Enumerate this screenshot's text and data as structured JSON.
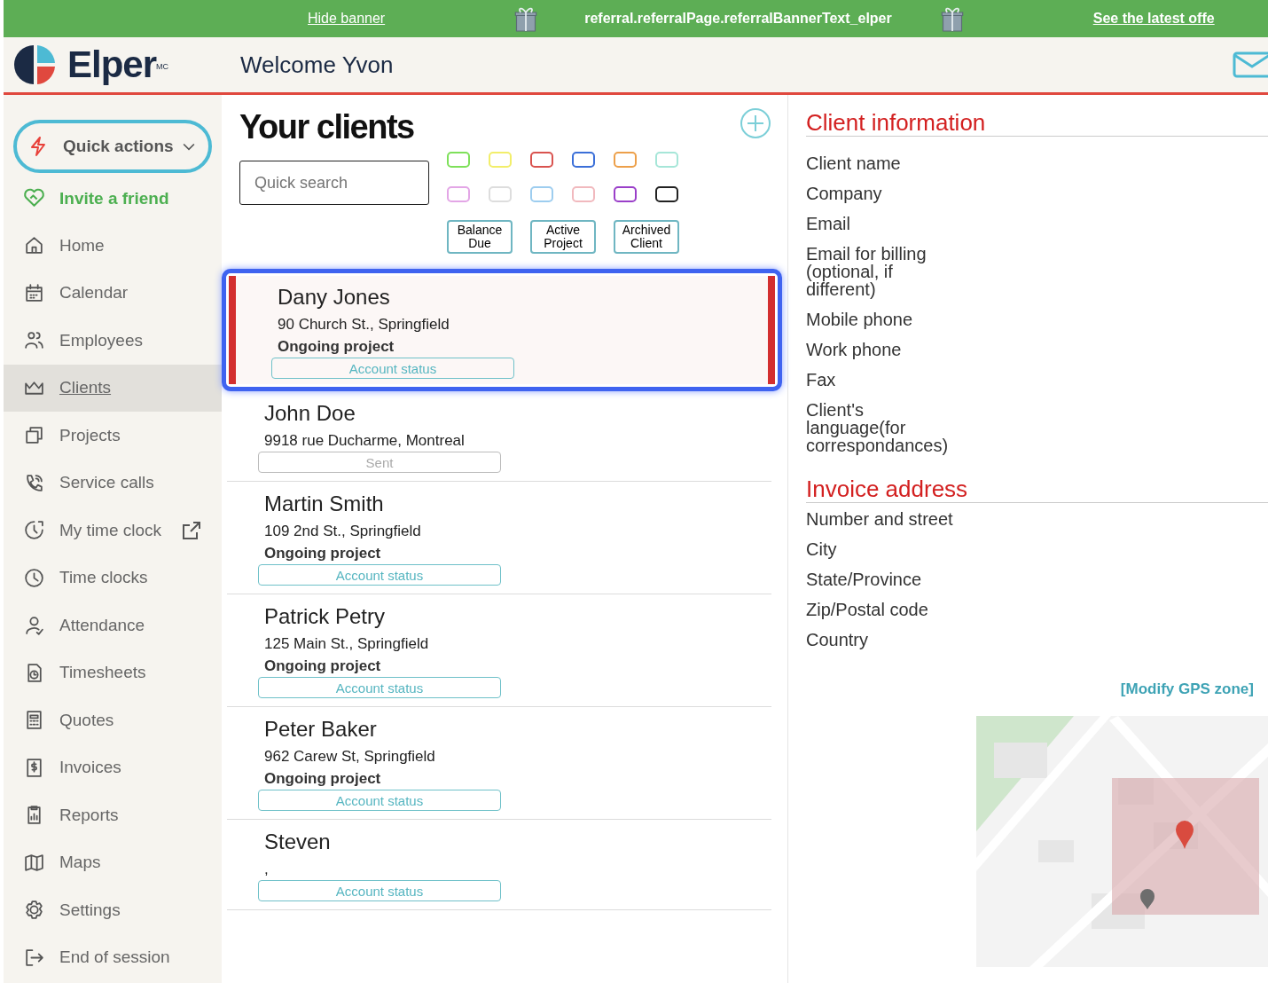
{
  "banner": {
    "hide_link": "Hide banner",
    "text": "referral.referralPage.referralBannerText_elper",
    "offer_link": "See the latest offe"
  },
  "header": {
    "logo": "Elper",
    "logo_mark": "MC",
    "welcome": "Welcome Yvon"
  },
  "sidebar": {
    "quick_actions": "Quick actions",
    "invite": "Invite a friend",
    "items": [
      {
        "label": "Home",
        "selected": false,
        "external": false
      },
      {
        "label": "Calendar",
        "selected": false,
        "external": false
      },
      {
        "label": "Employees",
        "selected": false,
        "external": false
      },
      {
        "label": "Clients",
        "selected": true,
        "external": false
      },
      {
        "label": "Projects",
        "selected": false,
        "external": false
      },
      {
        "label": "Service calls",
        "selected": false,
        "external": false
      },
      {
        "label": "My time clock",
        "selected": false,
        "external": true
      },
      {
        "label": "Time clocks",
        "selected": false,
        "external": false
      },
      {
        "label": "Attendance",
        "selected": false,
        "external": false
      },
      {
        "label": "Timesheets",
        "selected": false,
        "external": false
      },
      {
        "label": "Quotes",
        "selected": false,
        "external": false
      },
      {
        "label": "Invoices",
        "selected": false,
        "external": false
      },
      {
        "label": "Reports",
        "selected": false,
        "external": false
      },
      {
        "label": "Maps",
        "selected": false,
        "external": false
      },
      {
        "label": "Settings",
        "selected": false,
        "external": false
      },
      {
        "label": "End of session",
        "selected": false,
        "external": false
      }
    ]
  },
  "clients_panel": {
    "title": "Your clients",
    "search": {
      "placeholder": "Quick search"
    },
    "color_filters": [
      {
        "color": "#7ee05a"
      },
      {
        "color": "#f2ee6a"
      },
      {
        "color": "#d9534f"
      },
      {
        "color": "#3b6fd8"
      },
      {
        "color": "#eda04a"
      },
      {
        "color": "#a6e6d8"
      },
      {
        "color": "#e3a6e6"
      },
      {
        "color": "#dddddd"
      },
      {
        "color": "#9dcdef"
      },
      {
        "color": "#f1b9be"
      },
      {
        "color": "#9a3fc9"
      },
      {
        "color": "#222222"
      }
    ],
    "tag_filters": [
      "Balance\nDue",
      "Active\nProject",
      "Archived\nClient"
    ],
    "clients": [
      {
        "name": "Dany Jones",
        "address": "90 Church St., Springfield",
        "status": "Ongoing project",
        "button": {
          "label": "Account status",
          "kind": "status"
        },
        "selected": true
      },
      {
        "name": "John Doe",
        "address": "9918 rue Ducharme, Montreal",
        "button": {
          "label": "Sent",
          "kind": "sent"
        },
        "selected": false
      },
      {
        "name": "Martin Smith",
        "address": "109 2nd St., Springfield",
        "status": "Ongoing project",
        "button": {
          "label": "Account status",
          "kind": "status"
        },
        "selected": false
      },
      {
        "name": "Patrick Petry",
        "address": "125 Main St., Springfield",
        "status": "Ongoing project",
        "button": {
          "label": "Account status",
          "kind": "status"
        },
        "selected": false
      },
      {
        "name": "Peter Baker",
        "address": "962 Carew St, Springfield",
        "status": "Ongoing project",
        "button": {
          "label": "Account status",
          "kind": "status"
        },
        "selected": false
      },
      {
        "name": "Steven",
        "address": ",",
        "button": {
          "label": "Account status",
          "kind": "status"
        },
        "selected": false
      }
    ]
  },
  "client_information": {
    "title": "Client information",
    "fields": [
      "Client name",
      "Company",
      "Email",
      "Email for billing (optional, if different)",
      "Mobile phone",
      "Work phone",
      "Fax",
      "Client's language(for correspondances)"
    ]
  },
  "invoice_address": {
    "title": "Invoice address",
    "fields": [
      "Number and street",
      "City",
      "State/Province",
      "Zip/Postal code",
      "Country"
    ]
  },
  "gps": {
    "link": "[Modify GPS zone]"
  }
}
